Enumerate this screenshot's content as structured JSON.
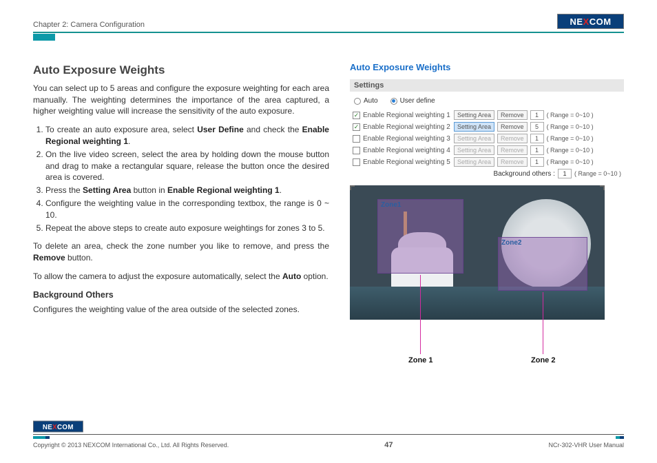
{
  "header": {
    "chapter": "Chapter 2: Camera Configuration",
    "brand_pre": "NE",
    "brand_x": "X",
    "brand_post": "COM"
  },
  "left": {
    "title": "Auto Exposure Weights",
    "intro": "You can select up to 5 areas and configure the exposure weighting for each area manually. The weighting determines the importance of the area captured, a higher weighting value will increase the sensitivity of the auto exposure.",
    "step1_a": "To create an auto exposure area, select ",
    "step1_b": "User Define",
    "step1_c": " and check the ",
    "step1_d": "Enable Regional weighting 1",
    "step1_e": ".",
    "step2": "On the live video screen, select the area by holding down the mouse button and drag to make a rectangular square, release the button once the desired area is covered.",
    "step3_a": "Press the ",
    "step3_b": "Setting Area",
    "step3_c": " button in ",
    "step3_d": "Enable Regional weighting 1",
    "step3_e": ".",
    "step4": "Configure the weighting value in the corresponding textbox, the range is 0 ~ 10.",
    "step5": "Repeat the above steps to create auto exposure weightings for zones 3 to 5.",
    "del_a": "To delete an area, check the zone number you like to remove, and press the ",
    "del_b": "Remove",
    "del_c": " button.",
    "auto_a": "To allow the camera to adjust the exposure automatically, select the ",
    "auto_b": "Auto",
    "auto_c": " option.",
    "bg_title": "Background Others",
    "bg_text": "Configures the weighting value of the area outside of the selected zones."
  },
  "panel": {
    "title": "Auto Exposure Weights",
    "settings": "Settings",
    "auto": "Auto",
    "userdef": "User define",
    "setting_area": "Setting Area",
    "remove": "Remove",
    "range": "( Range = 0~10 )",
    "bg_label": "Background others :",
    "rows": [
      {
        "label": "Enable Regional weighting 1",
        "checked": true,
        "active": false,
        "val": "1"
      },
      {
        "label": "Enable Regional weighting 2",
        "checked": true,
        "active": true,
        "val": "5"
      },
      {
        "label": "Enable Regional weighting 3",
        "checked": false,
        "active": false,
        "val": "1"
      },
      {
        "label": "Enable Regional weighting 4",
        "checked": false,
        "active": false,
        "val": "1"
      },
      {
        "label": "Enable Regional weighting 5",
        "checked": false,
        "active": false,
        "val": "1"
      }
    ],
    "bg_val": "1"
  },
  "zones": {
    "z1": "Zone1",
    "z2": "Zone2",
    "label1": "Zone 1",
    "label2": "Zone 2"
  },
  "footer": {
    "copyright": "Copyright © 2013 NEXCOM International Co., Ltd. All Rights Reserved.",
    "page": "47",
    "manual": "NCr-302-VHR User Manual"
  }
}
